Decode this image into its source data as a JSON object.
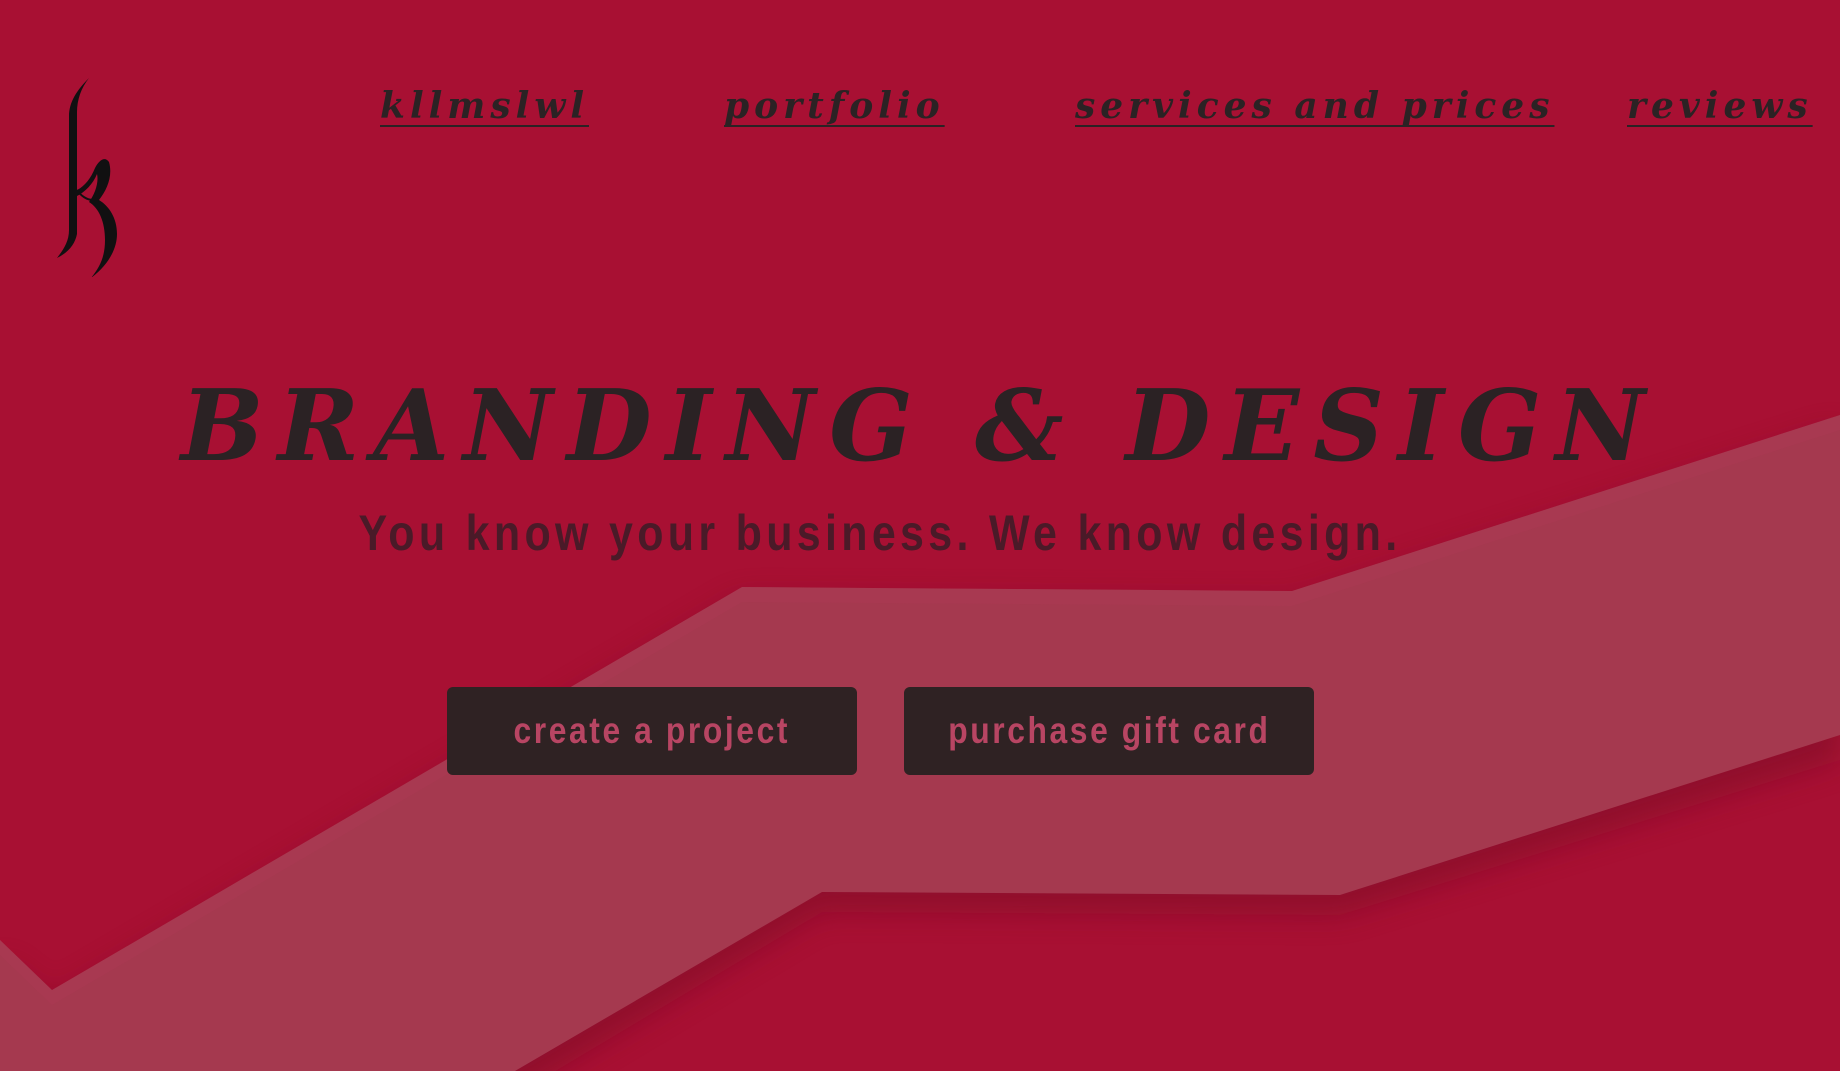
{
  "logo": {
    "letter": "k"
  },
  "nav": {
    "items": [
      {
        "label": "kllmslwl"
      },
      {
        "label": "portfolio"
      },
      {
        "label": "services and prices"
      },
      {
        "label": "reviews"
      }
    ]
  },
  "hero": {
    "headline": "BRANDING & DESIGN",
    "tagline": "You know your business. We know design."
  },
  "actions": {
    "create_label": "create a project",
    "gift_label": "purchase gift card"
  },
  "colors": {
    "background": "#a81033",
    "band": "#a5394f",
    "text_dark": "#2b2224",
    "button_bg": "#2f2223",
    "button_text": "#b84563"
  }
}
